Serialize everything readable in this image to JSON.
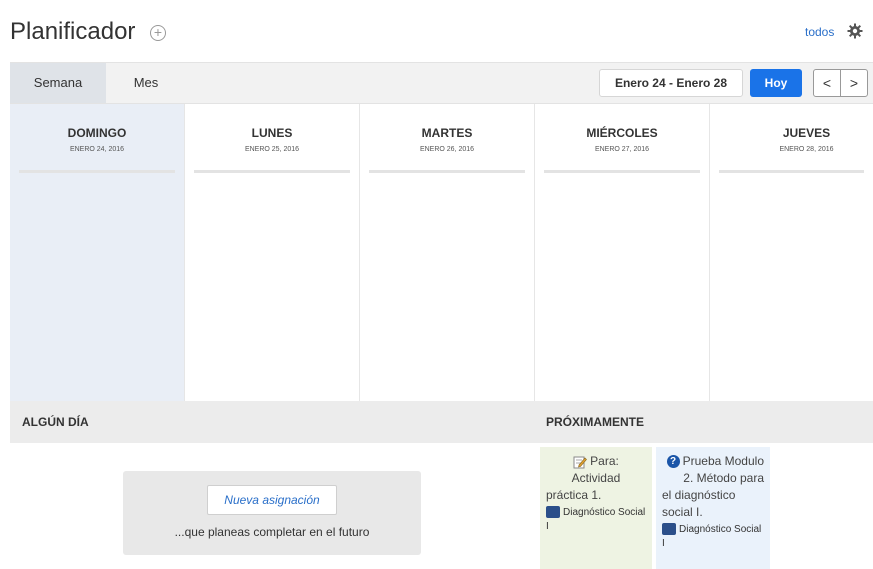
{
  "header": {
    "title": "Planificador",
    "add_symbol": "+",
    "filter_link": "todos"
  },
  "toolbar": {
    "tabs": [
      {
        "label": "Semana",
        "active": true
      },
      {
        "label": "Mes",
        "active": false
      }
    ],
    "range": "Enero 24 - Enero 28",
    "today_label": "Hoy",
    "prev_symbol": "<",
    "next_symbol": ">"
  },
  "week": {
    "days": [
      {
        "name": "DOMINGO",
        "date": "ENERO 24, 2016",
        "today": true
      },
      {
        "name": "LUNES",
        "date": "ENERO 25, 2016"
      },
      {
        "name": "MARTES",
        "date": "ENERO 26, 2016"
      },
      {
        "name": "MIÉRCOLES",
        "date": "ENERO 27, 2016"
      },
      {
        "name": "JUEVES",
        "date": "ENERO 28, 2016"
      }
    ]
  },
  "someday": {
    "heading": "ALGÚN DÍA",
    "new_button": "Nueva asignación",
    "hint": "...que planeas completar en el futuro"
  },
  "upcoming": {
    "heading": "PRÓXIMAMENTE",
    "items": [
      {
        "icon": "edit-icon",
        "lines": [
          "Para:",
          "Actividad",
          "práctica 1."
        ],
        "course": "Diagnóstico Social I"
      },
      {
        "icon": "quiz-icon",
        "lines": [
          "Prueba Modulo",
          "2. Método para",
          "el diagnóstico",
          "social I."
        ],
        "course": "Diagnóstico Social I"
      }
    ]
  },
  "colors": {
    "accent": "#1a73e8",
    "link": "#2a6fc9",
    "today_column": "#e9eef6",
    "course_swatch": "#2b4f8a"
  }
}
